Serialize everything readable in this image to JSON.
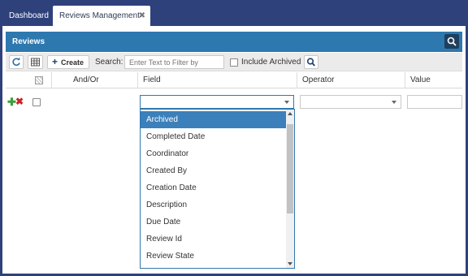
{
  "tabs": {
    "dashboard": "Dashboard",
    "reviews": "Reviews Management",
    "close_glyph": "✖"
  },
  "panel": {
    "title": "Reviews"
  },
  "toolbar": {
    "create_label": "Create",
    "search_label": "Search:",
    "search_placeholder": "Enter Text to Filter by",
    "include_archived_label": "Include Archived"
  },
  "grid": {
    "columns": {
      "and_or": "And/Or",
      "field": "Field",
      "operator": "Operator",
      "value": "Value"
    }
  },
  "field_options": [
    "Archived",
    "Completed Date",
    "Coordinator",
    "Created By",
    "Creation Date",
    "Description",
    "Due Date",
    "Review Id",
    "Review State"
  ],
  "icons": {
    "refresh": "refresh-icon",
    "grid": "grid-icon",
    "search": "search-icon",
    "add": "add-icon",
    "delete": "delete-icon"
  },
  "colors": {
    "header_blue": "#2e78b0",
    "frame_navy": "#2f417a",
    "selected_option": "#3b80ba"
  }
}
